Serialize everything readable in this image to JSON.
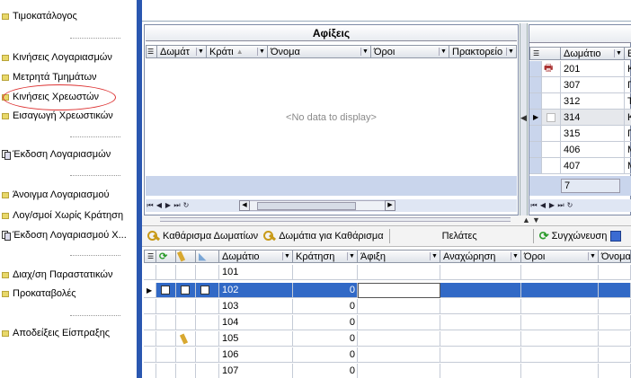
{
  "sidebar": {
    "items": [
      {
        "label": "Τιμοκατάλογος",
        "icon": "folder-icon"
      },
      {
        "label": "Κινήσεις Λογαριασμών",
        "icon": "folder-icon"
      },
      {
        "label": "Μετρητά Τμημάτων",
        "icon": "folder-icon"
      },
      {
        "label": "Κινήσεις Χρεωστών",
        "icon": "folder-icon"
      },
      {
        "label": "Εισαγωγή Χρεωστικών",
        "icon": "folder-icon"
      },
      {
        "label": "Έκδοση Λογαριασμών",
        "icon": "document-icon"
      },
      {
        "label": "Άνοιγμα Λογαριασμού",
        "icon": "folder-icon"
      },
      {
        "label": "Λογ/σμοί Χωρίς Κράτηση",
        "icon": "folder-icon"
      },
      {
        "label": "Έκδοση Λογαριασμού Χ...",
        "icon": "document-icon"
      },
      {
        "label": "Διαχ/ση Παραστατικών",
        "icon": "folder-icon"
      },
      {
        "label": "Προκαταβολές",
        "icon": "folder-icon"
      },
      {
        "label": "Αποδείξεις Είσπραξης",
        "icon": "folder-icon"
      }
    ]
  },
  "arrivals": {
    "title": "Αφίξεις",
    "columns": [
      "Δωμάτ",
      "Κράτι",
      "Όνομα",
      "Όροι",
      "Πρακτορείο"
    ],
    "empty_text": "<No data to display>"
  },
  "rooms_panel": {
    "columns": [
      "Δωμάτιο",
      "Ε"
    ],
    "rows": [
      {
        "room": "201",
        "name": "Κ"
      },
      {
        "room": "307",
        "name": "Π"
      },
      {
        "room": "312",
        "name": "Τ"
      },
      {
        "room": "314",
        "name": "Κ"
      },
      {
        "room": "315",
        "name": "Γ"
      },
      {
        "room": "406",
        "name": "Μ"
      },
      {
        "room": "407",
        "name": "Μ"
      }
    ],
    "count": "7"
  },
  "toolbar": {
    "clean_rooms": "Καθάρισμα Δωματίων",
    "rooms_to_clean": "Δωμάτια για Καθάρισμα",
    "customers": "Πελάτες",
    "sync": "Συγχώνευση"
  },
  "housekeeping": {
    "columns": [
      "Δωμάτιο",
      "Κράτηση",
      "Άφιξη",
      "Αναχώρηση",
      "Όροι",
      "Όνομα"
    ],
    "rows": [
      {
        "room": "101",
        "res": ""
      },
      {
        "room": "102",
        "res": "0"
      },
      {
        "room": "103",
        "res": "0"
      },
      {
        "room": "104",
        "res": "0"
      },
      {
        "room": "105",
        "res": "0"
      },
      {
        "room": "106",
        "res": "0"
      },
      {
        "room": "107",
        "res": "0"
      }
    ]
  },
  "colors": {
    "selection": "#3169c6",
    "divider": "#2a57b0",
    "navbar": "#c9d5ec"
  }
}
